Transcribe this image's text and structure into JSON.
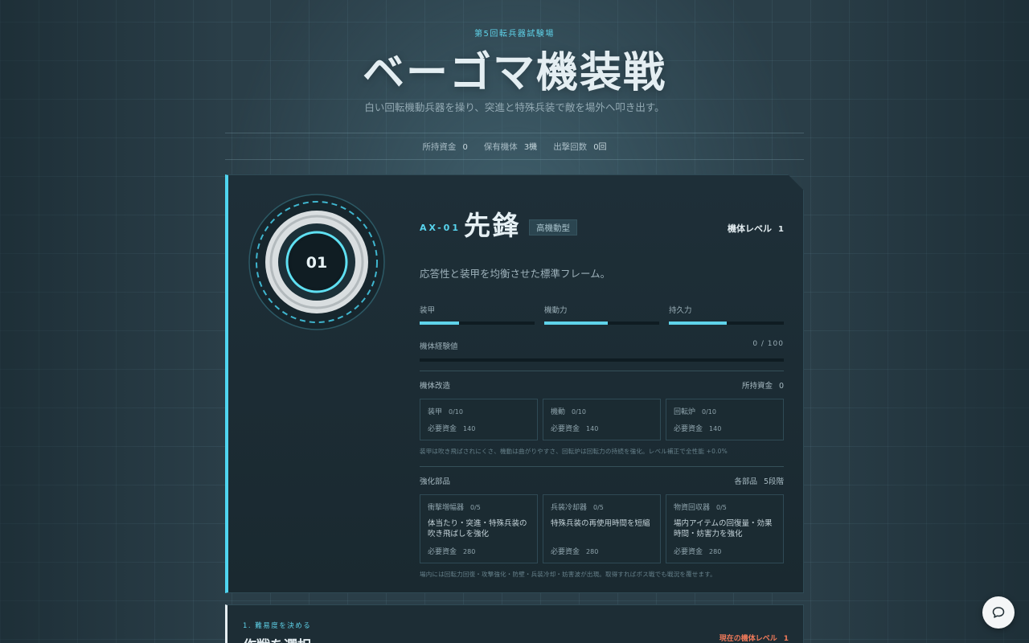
{
  "header": {
    "eyebrow": "第5回転兵器試験場",
    "title": "ベーゴマ機装戦",
    "subtitle": "白い回転機動兵器を操り、突進と特殊兵装で敵を場外へ叩き出す。"
  },
  "stats": [
    {
      "label": "所持資金",
      "value": "0"
    },
    {
      "label": "保有機体",
      "value": "3機"
    },
    {
      "label": "出撃回数",
      "value": "0回"
    }
  ],
  "unit": {
    "emblem_number": "01",
    "code": "AX-01",
    "name": "先鋒",
    "type_badge": "高機動型",
    "level_label": "機体レベル",
    "level_value": "1",
    "description": "応答性と装甲を均衡させた標準フレーム。",
    "attributes": [
      {
        "label": "装甲",
        "level": 0.34
      },
      {
        "label": "機動力",
        "level": 0.55
      },
      {
        "label": "持久力",
        "level": 0.5
      }
    ],
    "exp_label": "機体経験値",
    "exp_text": "0 / 100",
    "exp_fraction": 0
  },
  "modification": {
    "title": "機体改造",
    "funds_label": "所持資金",
    "funds_value": "0",
    "items": [
      {
        "name": "装甲",
        "progress": "0/10",
        "cost_label": "必要資金",
        "cost": "140"
      },
      {
        "name": "機動",
        "progress": "0/10",
        "cost_label": "必要資金",
        "cost": "140"
      },
      {
        "name": "回転炉",
        "progress": "0/10",
        "cost_label": "必要資金",
        "cost": "140"
      }
    ],
    "note": "装甲は吹き飛ばされにくさ、機動は曲がりやすさ、回転炉は回転力の持続を強化。レベル補正で全性能 +0.0%"
  },
  "parts": {
    "title": "強化部品",
    "right_label": "各部品",
    "right_value": "5段階",
    "items": [
      {
        "name": "衝撃増幅器",
        "progress": "0/5",
        "effect": "体当たり・突進・特殊兵装の吹き飛ばしを強化",
        "cost_label": "必要資金",
        "cost": "280"
      },
      {
        "name": "兵装冷却器",
        "progress": "0/5",
        "effect": "特殊兵装の再使用時間を短縮",
        "cost_label": "必要資金",
        "cost": "280"
      },
      {
        "name": "物資回収器",
        "progress": "0/5",
        "effect": "場内アイテムの回復量・効果時間・妨害力を強化",
        "cost_label": "必要資金",
        "cost": "280"
      }
    ],
    "note": "場内には回転力回復・攻撃強化・防壁・兵装冷却・妨害波が出現。取得すればボス戦でも戦況を覆せます。"
  },
  "mission": {
    "step": "1. 難易度を決める",
    "title": "作戦を選択",
    "level_label": "現在の機体レベル",
    "level_value": "1"
  },
  "colors": {
    "accent": "#5fd3ea",
    "warning": "#f07a5a",
    "background": "#2a3e48"
  },
  "icons": {
    "chat": "chat-bubble-icon"
  }
}
